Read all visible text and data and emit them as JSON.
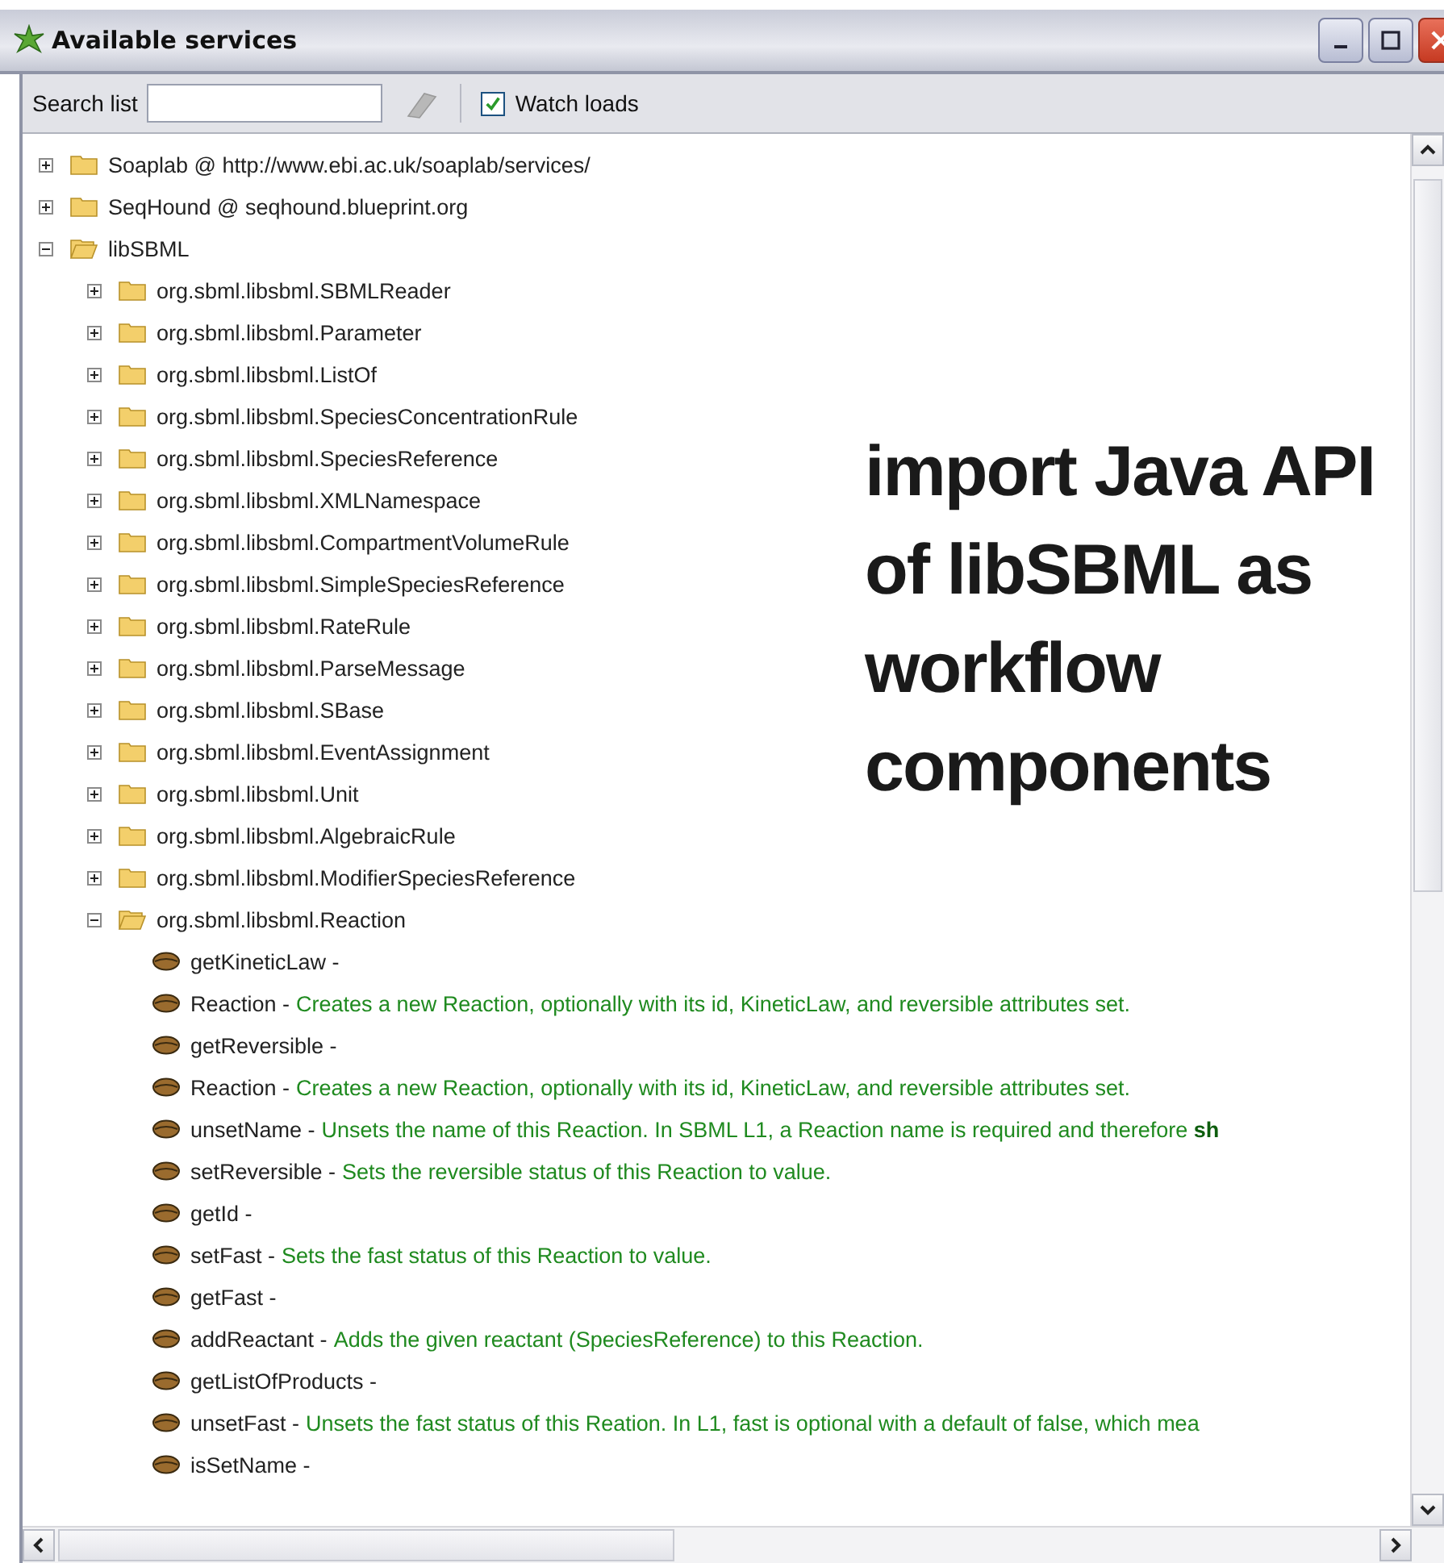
{
  "window": {
    "title": "Available services"
  },
  "toolbar": {
    "search_label": "Search list",
    "watch_loads": {
      "label": "Watch loads",
      "checked": true
    }
  },
  "tree": [
    {
      "kind": "folder",
      "label": "Soaplab @ http://www.ebi.ac.uk/soaplab/services/",
      "expanded": false
    },
    {
      "kind": "folder",
      "label": "SeqHound @ seqhound.blueprint.org",
      "expanded": false
    },
    {
      "kind": "folder",
      "label": "libSBML",
      "expanded": true,
      "children": [
        {
          "kind": "folder",
          "label": "org.sbml.libsbml.SBMLReader",
          "expanded": false
        },
        {
          "kind": "folder",
          "label": "org.sbml.libsbml.Parameter",
          "expanded": false
        },
        {
          "kind": "folder",
          "label": "org.sbml.libsbml.ListOf",
          "expanded": false
        },
        {
          "kind": "folder",
          "label": "org.sbml.libsbml.SpeciesConcentrationRule",
          "expanded": false
        },
        {
          "kind": "folder",
          "label": "org.sbml.libsbml.SpeciesReference",
          "expanded": false
        },
        {
          "kind": "folder",
          "label": "org.sbml.libsbml.XMLNamespace",
          "expanded": false
        },
        {
          "kind": "folder",
          "label": "org.sbml.libsbml.CompartmentVolumeRule",
          "expanded": false
        },
        {
          "kind": "folder",
          "label": "org.sbml.libsbml.SimpleSpeciesReference",
          "expanded": false
        },
        {
          "kind": "folder",
          "label": "org.sbml.libsbml.RateRule",
          "expanded": false
        },
        {
          "kind": "folder",
          "label": "org.sbml.libsbml.ParseMessage",
          "expanded": false
        },
        {
          "kind": "folder",
          "label": "org.sbml.libsbml.SBase",
          "expanded": false
        },
        {
          "kind": "folder",
          "label": "org.sbml.libsbml.EventAssignment",
          "expanded": false
        },
        {
          "kind": "folder",
          "label": "org.sbml.libsbml.Unit",
          "expanded": false
        },
        {
          "kind": "folder",
          "label": "org.sbml.libsbml.AlgebraicRule",
          "expanded": false
        },
        {
          "kind": "folder",
          "label": "org.sbml.libsbml.ModifierSpeciesReference",
          "expanded": false
        },
        {
          "kind": "folder",
          "label": "org.sbml.libsbml.Reaction",
          "expanded": true,
          "children": [
            {
              "kind": "method",
              "label": "getKineticLaw -"
            },
            {
              "kind": "method",
              "label": "Reaction -",
              "description": "Creates a new Reaction, optionally with its id, KineticLaw, and reversible attributes set."
            },
            {
              "kind": "method",
              "label": "getReversible -"
            },
            {
              "kind": "method",
              "label": "Reaction -",
              "description": "Creates a new Reaction, optionally with its id, KineticLaw, and reversible attributes set."
            },
            {
              "kind": "method",
              "label": "unsetName -",
              "description": "Unsets the name of this Reaction. In SBML L1, a Reaction name is required and therefore **sh**"
            },
            {
              "kind": "method",
              "label": "setReversible -",
              "description": "Sets the reversible status of this Reaction to value."
            },
            {
              "kind": "method",
              "label": "getId -"
            },
            {
              "kind": "method",
              "label": "setFast -",
              "description": "Sets the fast status of this Reaction to value."
            },
            {
              "kind": "method",
              "label": "getFast -"
            },
            {
              "kind": "method",
              "label": "addReactant -",
              "description": "Adds the given reactant (SpeciesReference) to this Reaction."
            },
            {
              "kind": "method",
              "label": "getListOfProducts -"
            },
            {
              "kind": "method",
              "label": "unsetFast -",
              "description": "Unsets the fast status of this Reation. In L1, fast is optional with a default of false, which mea"
            },
            {
              "kind": "method",
              "label": "isSetName -"
            }
          ]
        }
      ]
    }
  ],
  "overlay": {
    "text": "import Java API of libSBML as workflow components"
  }
}
